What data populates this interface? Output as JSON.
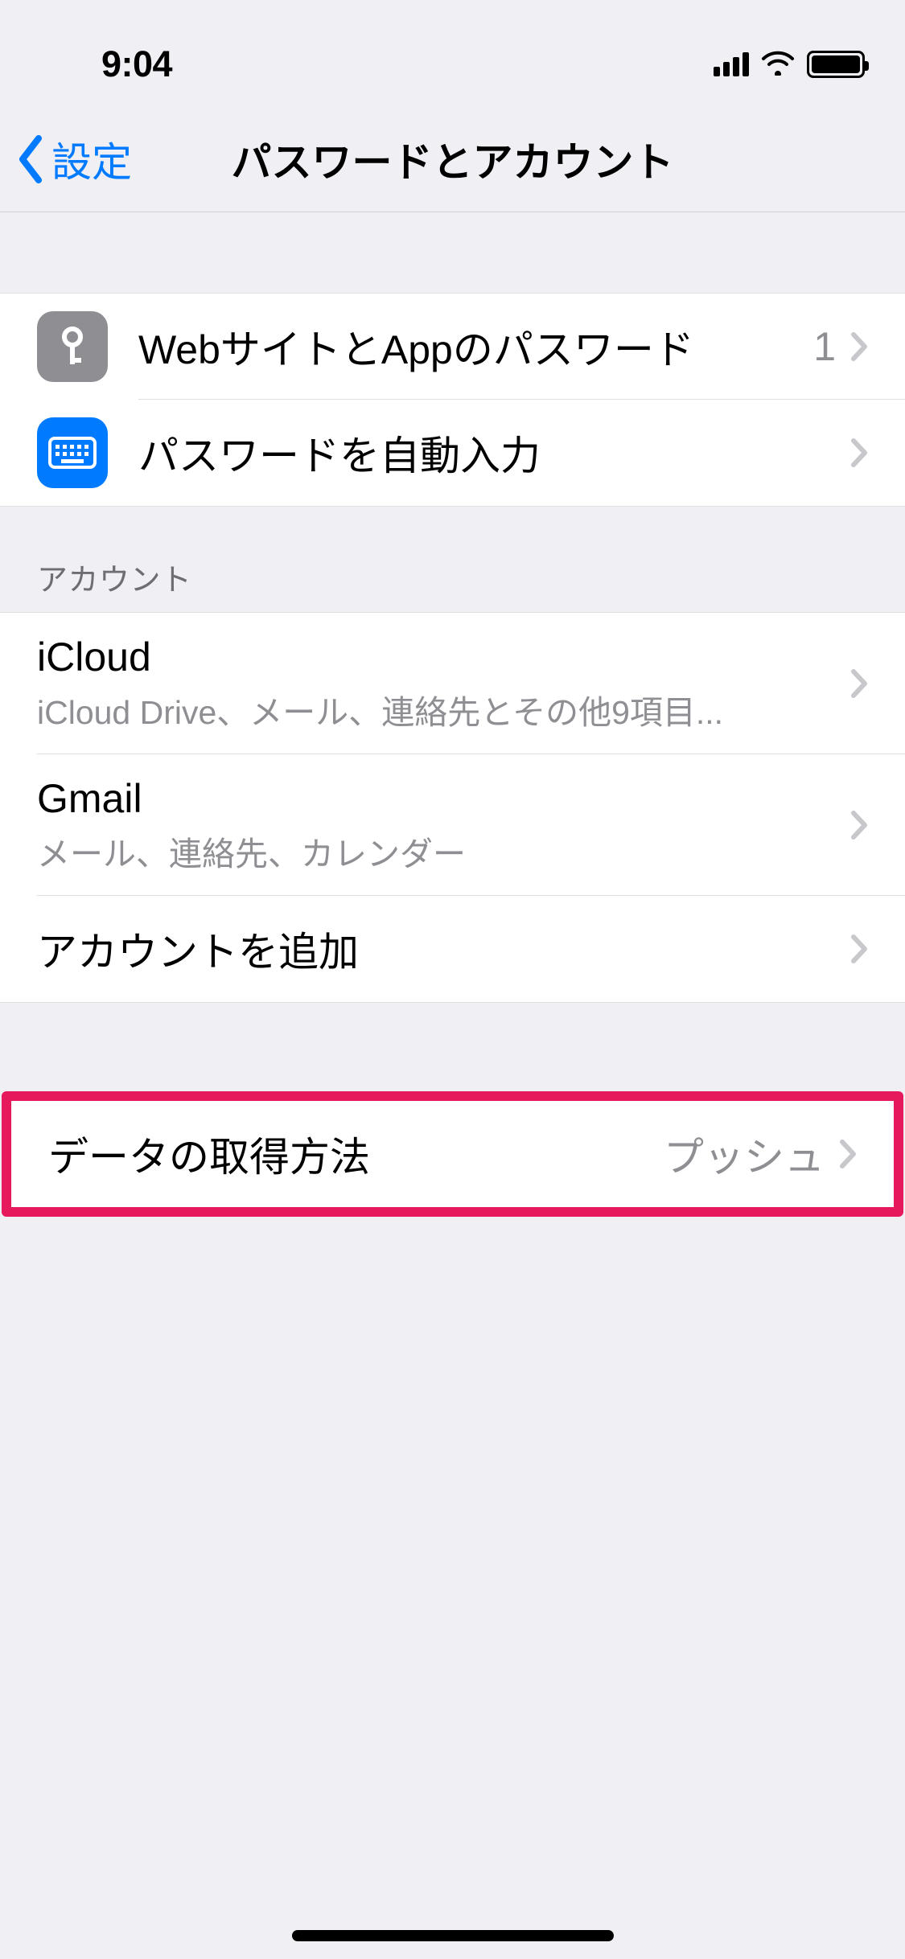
{
  "statusbar": {
    "time": "9:04"
  },
  "nav": {
    "back_label": "設定",
    "title": "パスワードとアカウント"
  },
  "passwords_section": {
    "web_app_passwords": {
      "label": "WebサイトとAppのパスワード",
      "count": "1"
    },
    "autofill": {
      "label": "パスワードを自動入力"
    }
  },
  "accounts_section": {
    "header": "アカウント",
    "icloud": {
      "title": "iCloud",
      "subtitle": "iCloud Drive、メール、連絡先とその他9項目..."
    },
    "gmail": {
      "title": "Gmail",
      "subtitle": "メール、連絡先、カレンダー"
    },
    "add_account": {
      "label": "アカウントを追加"
    }
  },
  "fetch_section": {
    "label": "データの取得方法",
    "value": "プッシュ"
  }
}
